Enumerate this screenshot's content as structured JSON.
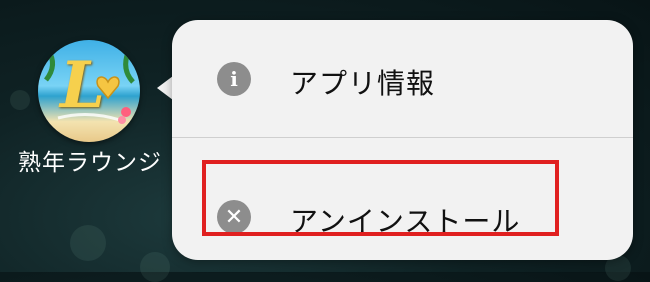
{
  "app": {
    "name": "熟年ラウンジ",
    "icon_name": "lounge-app-icon",
    "icon_letter": "L"
  },
  "context_menu": {
    "items": [
      {
        "label": "アプリ情報",
        "icon": "info-icon",
        "glyph": "i"
      },
      {
        "label": "アンインストール",
        "icon": "close-circle-icon",
        "glyph": "✕"
      }
    ]
  },
  "highlight_color": "#e02020"
}
